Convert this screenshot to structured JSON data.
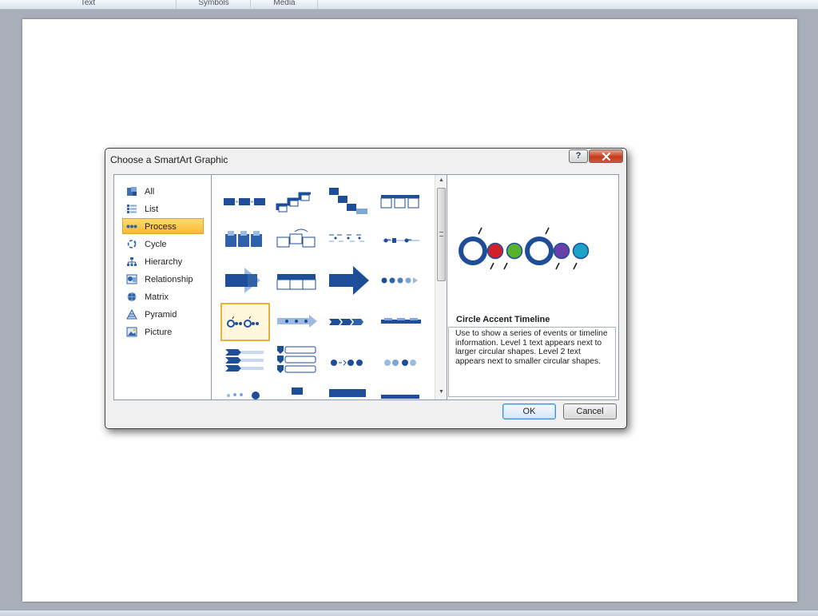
{
  "ribbon": {
    "groups": [
      "Text",
      "Symbols",
      "Media"
    ]
  },
  "dialog": {
    "title": "Choose a SmartArt Graphic",
    "help_label": "?",
    "close_label": "x",
    "categories": [
      {
        "label": "All",
        "icon": "all-icon"
      },
      {
        "label": "List",
        "icon": "list-icon"
      },
      {
        "label": "Process",
        "icon": "process-icon",
        "selected": true
      },
      {
        "label": "Cycle",
        "icon": "cycle-icon"
      },
      {
        "label": "Hierarchy",
        "icon": "hierarchy-icon"
      },
      {
        "label": "Relationship",
        "icon": "relationship-icon"
      },
      {
        "label": "Matrix",
        "icon": "matrix-icon"
      },
      {
        "label": "Pyramid",
        "icon": "pyramid-icon"
      },
      {
        "label": "Picture",
        "icon": "picture-icon"
      }
    ],
    "selected_category": "Process",
    "selected_layout": "Circle Accent Timeline",
    "preview": {
      "title": "Circle Accent Timeline",
      "description": "Use to show a series of events or timeline information. Level 1 text appears next to larger circular shapes. Level 2 text appears next to smaller circular shapes."
    },
    "buttons": {
      "ok": "OK",
      "cancel": "Cancel"
    },
    "colors": {
      "selection": "#f8bb2f",
      "smartart_blue": "#1f4e99",
      "accent_red": "#d0202a",
      "accent_green": "#58b22e",
      "accent_purple": "#6a3fa8",
      "accent_teal": "#1aa3c4"
    }
  }
}
